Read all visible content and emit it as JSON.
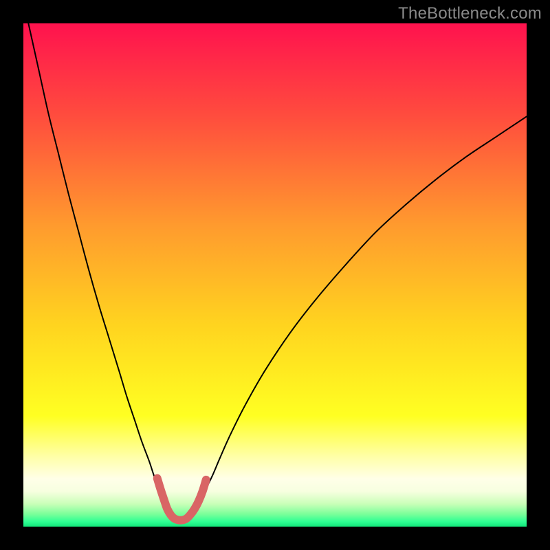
{
  "watermark": "TheBottleneck.com",
  "chart_data": {
    "type": "line",
    "title": "",
    "xlabel": "",
    "ylabel": "",
    "xlim": [
      0,
      100
    ],
    "ylim": [
      0,
      100
    ],
    "gradient_stops": [
      {
        "pos": 0.0,
        "color": "#ff124e"
      },
      {
        "pos": 0.18,
        "color": "#ff4b3e"
      },
      {
        "pos": 0.4,
        "color": "#ff9a2e"
      },
      {
        "pos": 0.6,
        "color": "#ffd41f"
      },
      {
        "pos": 0.78,
        "color": "#ffff22"
      },
      {
        "pos": 0.86,
        "color": "#ffffa6"
      },
      {
        "pos": 0.905,
        "color": "#ffffe8"
      },
      {
        "pos": 0.93,
        "color": "#f7ffe0"
      },
      {
        "pos": 0.955,
        "color": "#c9ffb8"
      },
      {
        "pos": 0.975,
        "color": "#7bff9a"
      },
      {
        "pos": 0.99,
        "color": "#2fff93"
      },
      {
        "pos": 1.0,
        "color": "#12e67a"
      }
    ],
    "series": [
      {
        "name": "left-branch",
        "color": "#000000",
        "width": 2,
        "x": [
          1.0,
          3.0,
          5.0,
          7.0,
          9.0,
          11.0,
          13.0,
          15.0,
          17.0,
          19.0,
          20.5,
          22.0,
          23.5,
          25.0,
          26.0,
          27.0,
          28.0,
          28.8
        ],
        "y": [
          100.0,
          91.0,
          82.0,
          74.0,
          66.0,
          58.5,
          51.0,
          44.0,
          37.5,
          31.0,
          26.0,
          21.5,
          17.0,
          13.0,
          10.0,
          7.5,
          5.2,
          3.3
        ]
      },
      {
        "name": "right-branch",
        "color": "#000000",
        "width": 2,
        "x": [
          34.0,
          35.0,
          36.0,
          37.5,
          39.0,
          41.0,
          44.0,
          48.0,
          53.0,
          58.0,
          64.0,
          70.0,
          76.0,
          82.0,
          88.0,
          94.0,
          100.0
        ],
        "y": [
          3.3,
          5.0,
          7.0,
          10.0,
          13.5,
          18.0,
          24.0,
          31.0,
          38.5,
          45.0,
          52.0,
          58.5,
          64.0,
          69.0,
          73.5,
          77.5,
          81.5
        ]
      },
      {
        "name": "valley-highlight",
        "color": "#d96565",
        "width": 12,
        "x": [
          26.6,
          27.3,
          28.0,
          28.6,
          29.3,
          30.0,
          30.8,
          31.6,
          32.4,
          33.2,
          34.0,
          34.8,
          35.6,
          36.3
        ],
        "y": [
          9.6,
          7.3,
          5.2,
          3.5,
          2.3,
          1.6,
          1.3,
          1.3,
          1.6,
          2.4,
          3.5,
          5.0,
          7.0,
          9.3
        ]
      }
    ]
  }
}
